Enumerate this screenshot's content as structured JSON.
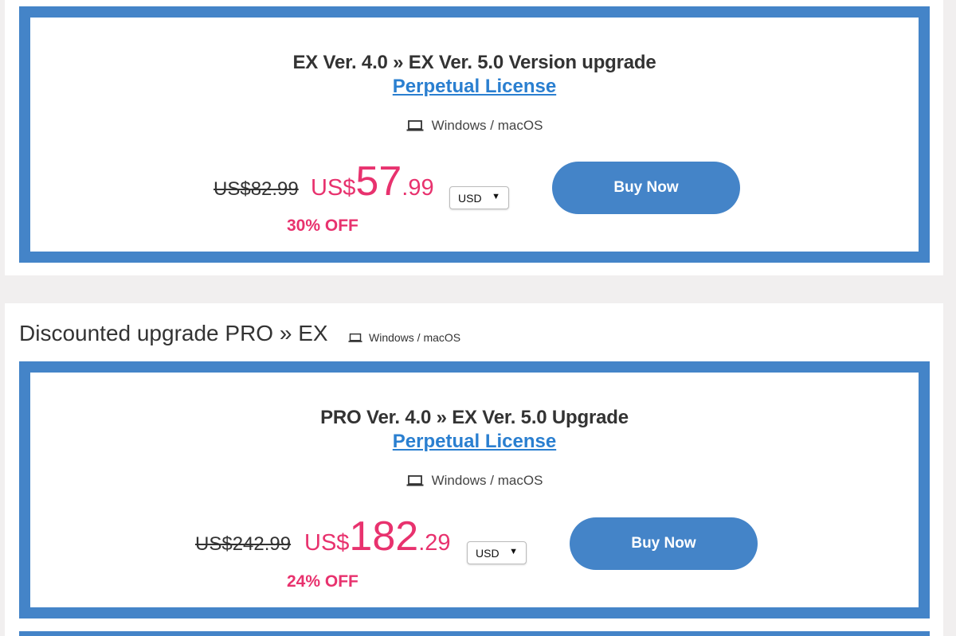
{
  "colors": {
    "accent": "#4484c8",
    "sale": "#e8326e",
    "link": "#2a7fd0"
  },
  "offer1": {
    "title": "EX Ver. 4.0 » EX Ver. 5.0 Version upgrade",
    "license": "Perpetual License",
    "platform": "Windows / macOS",
    "platform_icon": "laptop-icon",
    "original_price": "US$82.99",
    "sale_currency": "US$",
    "sale_int": "57",
    "sale_dec": ".99",
    "currency": "USD",
    "discount": "30% OFF",
    "buy_label": "Buy Now"
  },
  "section2": {
    "heading": "Discounted upgrade PRO » EX",
    "platform": "Windows / macOS",
    "platform_icon": "laptop-icon"
  },
  "offer2": {
    "title": "PRO Ver. 4.0 » EX Ver. 5.0 Upgrade",
    "license": "Perpetual License",
    "platform": "Windows / macOS",
    "platform_icon": "laptop-icon",
    "original_price": "US$242.99",
    "sale_currency": "US$",
    "sale_int": "182",
    "sale_dec": ".29",
    "currency": "USD",
    "discount": "24% OFF",
    "buy_label": "Buy Now"
  }
}
